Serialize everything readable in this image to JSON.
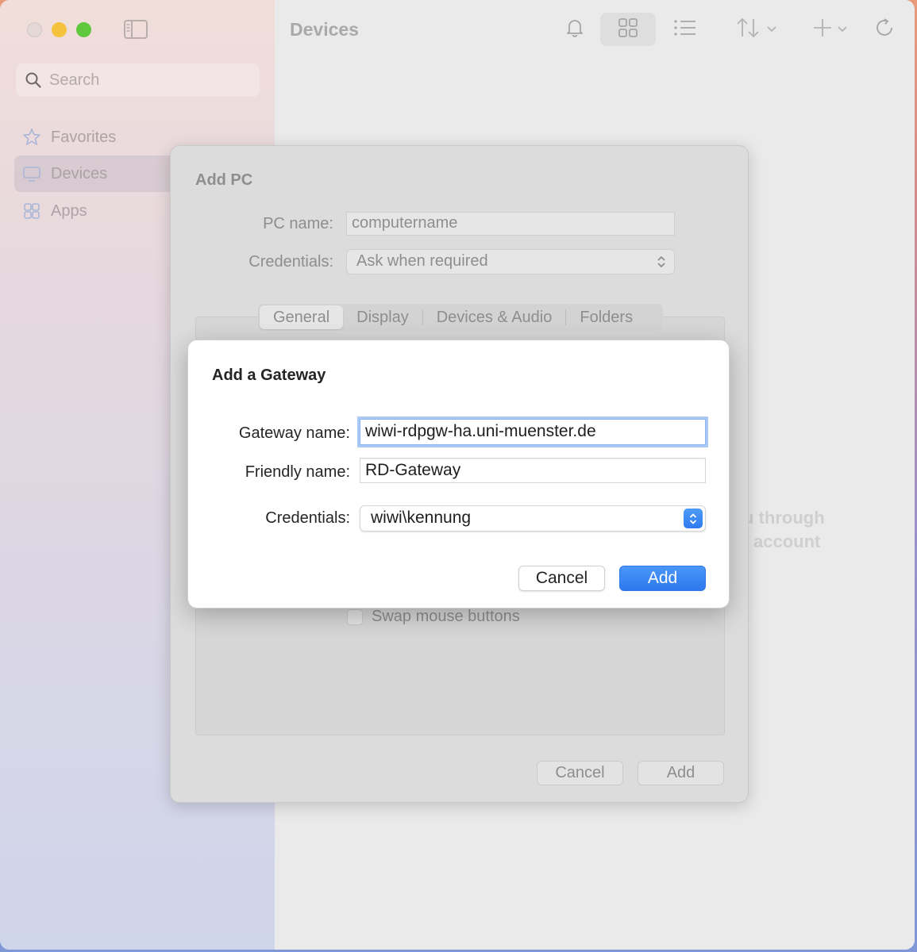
{
  "sidebar": {
    "search_placeholder": "Search",
    "items": [
      {
        "label": "Favorites",
        "icon": "star-icon"
      },
      {
        "label": "Devices",
        "icon": "monitor-icon",
        "active": true
      },
      {
        "label": "Apps",
        "icon": "apps-icon"
      }
    ]
  },
  "toolbar": {
    "title": "Devices"
  },
  "background": {
    "line1": "u through",
    "line2": "account"
  },
  "add_pc": {
    "title": "Add PC",
    "pc_name_label": "PC name:",
    "pc_name_value": "computername",
    "credentials_label": "Credentials:",
    "credentials_value": "Ask when required",
    "tabs": [
      "General",
      "Display",
      "Devices & Audio",
      "Folders"
    ],
    "swap_mouse_label": "Swap mouse buttons",
    "cancel_label": "Cancel",
    "add_label": "Add"
  },
  "gateway_dialog": {
    "title": "Add a Gateway",
    "gateway_name_label": "Gateway name:",
    "gateway_name_value": "wiwi-rdpgw-ha.uni-muenster.de",
    "friendly_name_label": "Friendly name:",
    "friendly_name_value": "RD-Gateway",
    "credentials_label": "Credentials:",
    "credentials_value": "wiwi\\kennung",
    "cancel_label": "Cancel",
    "add_label": "Add"
  },
  "colors": {
    "accent": "#2f7bf0",
    "traffic_min": "#f5c23e",
    "traffic_max": "#5fc83c"
  }
}
